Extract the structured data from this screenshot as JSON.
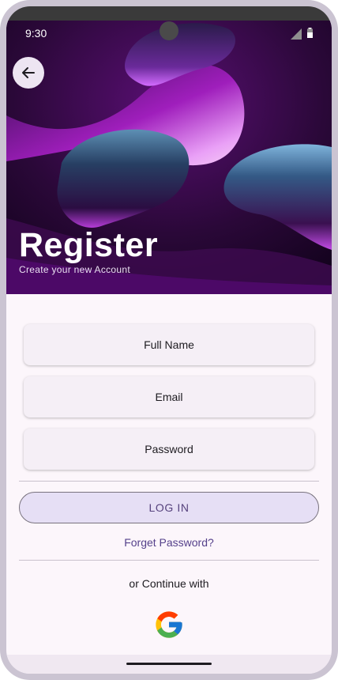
{
  "status": {
    "time": "9:30"
  },
  "header": {
    "title": "Register",
    "subtitle": "Create your new Account",
    "back_icon": "arrow-left-icon"
  },
  "form": {
    "fields": [
      {
        "label": "Full Name"
      },
      {
        "label": "Email"
      },
      {
        "label": "Password"
      }
    ]
  },
  "actions": {
    "login_label": "LOG IN",
    "forget_label": "Forget Password?",
    "continue_label": "or Continue with"
  },
  "social": {
    "google_icon": "google-icon"
  },
  "colors": {
    "accent": "#56427d",
    "button_bg": "#e6dff5",
    "background": "#fcf6fb"
  }
}
